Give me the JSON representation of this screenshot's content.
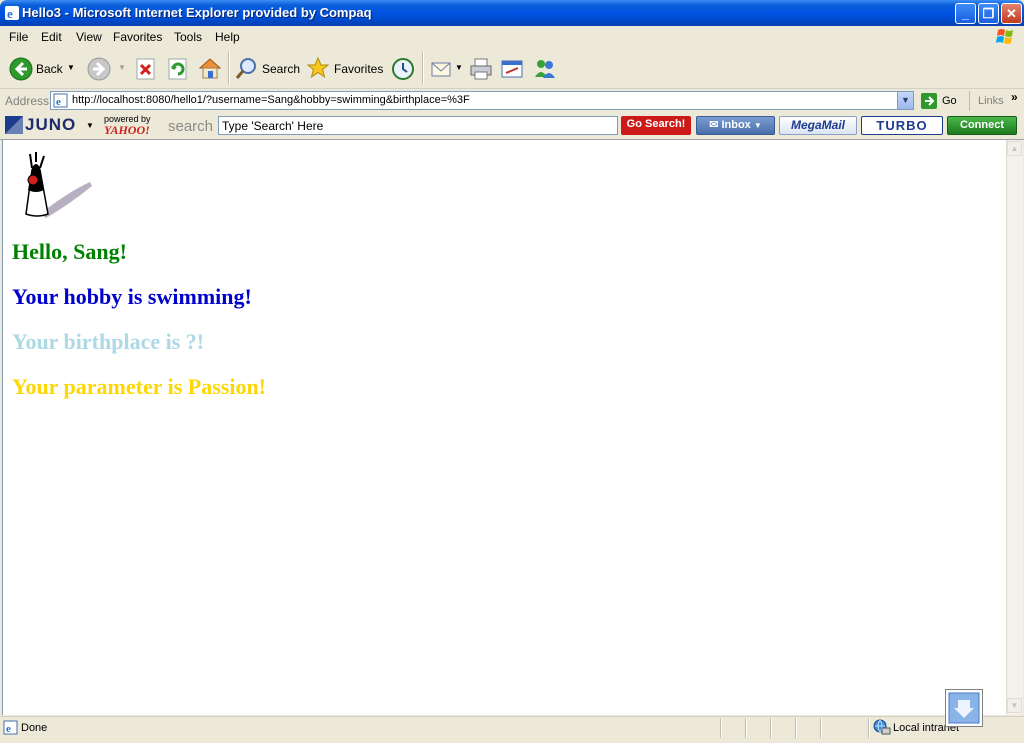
{
  "window": {
    "title": "Hello3 - Microsoft Internet Explorer provided by Compaq"
  },
  "menu": [
    "File",
    "Edit",
    "View",
    "Favorites",
    "Tools",
    "Help"
  ],
  "toolbar": {
    "back": "Back",
    "search": "Search",
    "favorites": "Favorites"
  },
  "address": {
    "label": "Address",
    "url": "http://localhost:8080/hello1/?username=Sang&hobby=swimming&birthplace=%3F",
    "go": "Go",
    "links": "Links"
  },
  "juno": {
    "brand": "JUNO",
    "powered_by": "powered by",
    "yahoo": "YAHOO!",
    "search_word": "search",
    "search_placeholder": "Type 'Search' Here",
    "go_search": "Go Search!",
    "inbox": "Inbox",
    "megamail": "MegaMail",
    "turbo": "TURBO",
    "connect": "Connect"
  },
  "page": {
    "greeting": "Hello, Sang!",
    "hobby": "Your hobby is swimming!",
    "birthplace": "Your birthplace is ?!",
    "parameter": "Your parameter is Passion!",
    "colors": {
      "greeting": "#008000",
      "hobby": "#0000cc",
      "birthplace": "#add8e6",
      "parameter": "#ffd700"
    }
  },
  "status": {
    "text": "Done",
    "zone": "Local intranet"
  }
}
